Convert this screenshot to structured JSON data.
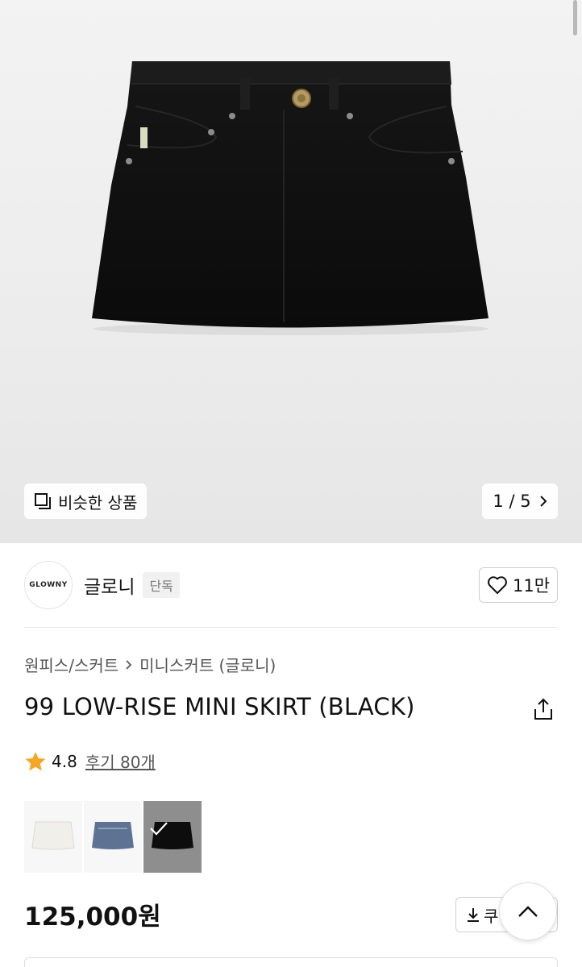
{
  "hero": {
    "similar_label": "비슷한 상품",
    "page_current": "1",
    "page_separator": "/",
    "page_total": "5"
  },
  "brand": {
    "logo_text": "GLOWNY",
    "name": "글로니",
    "badge": "단독",
    "like_count": "11만"
  },
  "breadcrumb": {
    "category": "원피스/스커트",
    "subcategory": "미니스커트 (글로니)"
  },
  "product": {
    "title": "99 LOW-RISE MINI SKIRT (BLACK)",
    "rating": "4.8",
    "review_label": "후기 80개",
    "price": "125,000원",
    "coupon_label": "쿠"
  },
  "colors": {
    "swatches": [
      {
        "name": "white",
        "fill": "#f1efea"
      },
      {
        "name": "blue-denim",
        "fill": "#5e7394"
      },
      {
        "name": "black",
        "fill": "#0d0d0d"
      }
    ],
    "selected_index": 2
  },
  "theme": {
    "star": "#f5a623",
    "text": "#111111",
    "muted": "#555555"
  },
  "icons": [
    "similar-icon",
    "chevron-right-icon",
    "heart-icon",
    "share-icon",
    "star-icon",
    "check-icon",
    "download-icon",
    "chevron-up-icon"
  ]
}
